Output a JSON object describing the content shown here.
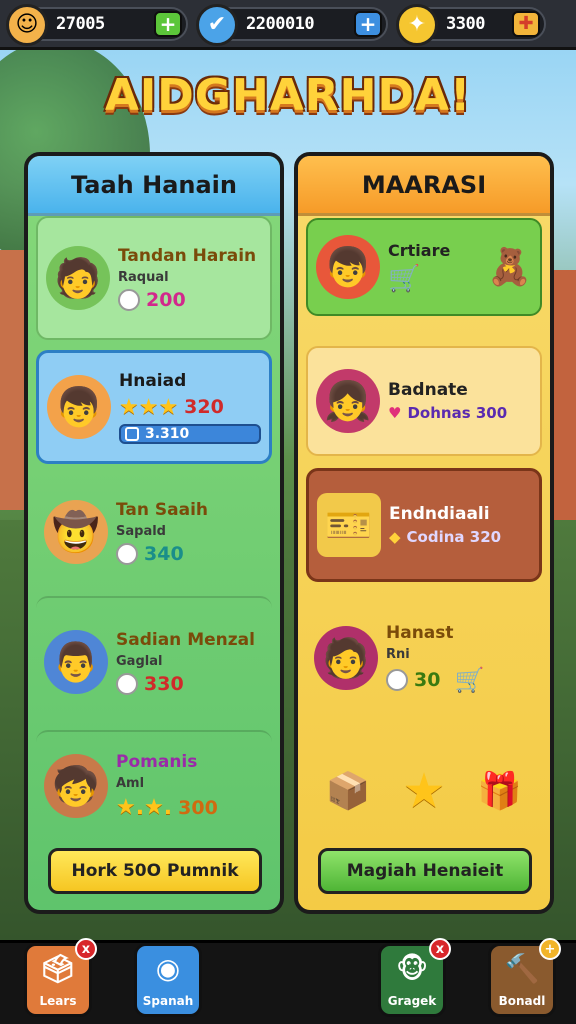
{
  "topbar": {
    "resources": [
      {
        "amount": "27005",
        "button": "+",
        "icon": "avatar-icon"
      },
      {
        "amount": "2200010",
        "button": "+",
        "icon": "shield-icon"
      },
      {
        "amount": "3300",
        "button": "gift",
        "icon": "feather-icon"
      }
    ]
  },
  "title": "AIDGHARHDA!",
  "left_panel": {
    "header": "Taah Hanain",
    "cards": [
      {
        "name": "Tandan Harain",
        "sub": "Raqual",
        "price": "200",
        "icon": "green-hat-character"
      },
      {
        "name": "Hnaiad",
        "sub": "",
        "price": "320",
        "progress_label": "3.310",
        "icon": "red-cap-character"
      },
      {
        "name": "Tan Saaih",
        "sub": "Sapald",
        "price": "340",
        "icon": "straw-hat-character"
      },
      {
        "name": "Sadian Menzal",
        "sub": "Gaglal",
        "price": "330",
        "icon": "blue-cap-character"
      },
      {
        "name": "Pomanis",
        "sub": "Aml",
        "price": "300",
        "icon": "kid-character"
      }
    ],
    "button": "Hork 50O Pumnik"
  },
  "right_panel": {
    "header": "MAARASI",
    "cards": [
      {
        "name": "Crtiare",
        "sub": "",
        "price": "",
        "icon": "red-cap-kid-character"
      },
      {
        "name": "Badnate",
        "sub": "",
        "price": "Dohnas 300",
        "icon": "curly-hair-character"
      },
      {
        "name": "Endndiaali",
        "sub": "",
        "price": "Codina 320",
        "icon": "coupon-icon"
      },
      {
        "name": "Hanast",
        "sub": "Rni",
        "price": "30",
        "icon": "afro-character"
      }
    ],
    "rewards": [
      "mystery-box-icon",
      "star-icon",
      "gift-box-icon"
    ],
    "button": "Magiah Henaieit"
  },
  "bottom_nav": [
    {
      "label": "Lears",
      "badge": "x"
    },
    {
      "label": "Spanah",
      "badge": ""
    },
    {
      "label": "Gragek",
      "badge": "x"
    },
    {
      "label": "Bonadl",
      "badge": "+"
    }
  ]
}
